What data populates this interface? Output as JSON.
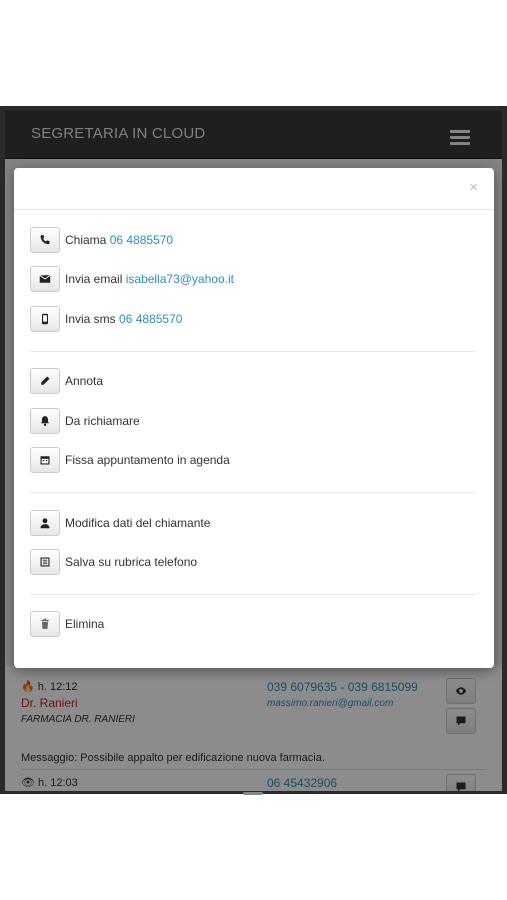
{
  "app": {
    "title": "SEGRETARIA IN CLOUD"
  },
  "modal": {
    "close_label": "×",
    "contact": {
      "call_label": "Chiama",
      "call_number": "06 4885570",
      "email_label": "Invia email",
      "email_address": "isabella73@yahoo.it",
      "sms_label": "Invia sms",
      "sms_number": "06 4885570"
    },
    "actions": {
      "annota": "Annota",
      "richiamare": "Da richiamare",
      "appuntamento": "Fissa appuntamento in agenda"
    },
    "manage": {
      "modifica": "Modifica dati del chiamante",
      "salva": "Salva su rubrica telefono"
    },
    "delete": {
      "elimina": "Elimina"
    }
  },
  "background_list": {
    "items": [
      {
        "time": "h. 12:12",
        "name": "Dr. Ranieri",
        "company": "FARMACIA DR. RANIERI",
        "phones": "039 6079635 - 039 6815099",
        "email": "massimo.ranieri@gmail.com",
        "message": "Messaggio: Possibile appalto per edificazione nuova farmacia."
      },
      {
        "time": "h. 12:03",
        "phones": "06 45432906"
      }
    ]
  },
  "colors": {
    "link": "#2a8fbd",
    "name_red": "#cc2222",
    "navbar": "#3a3a3a"
  }
}
